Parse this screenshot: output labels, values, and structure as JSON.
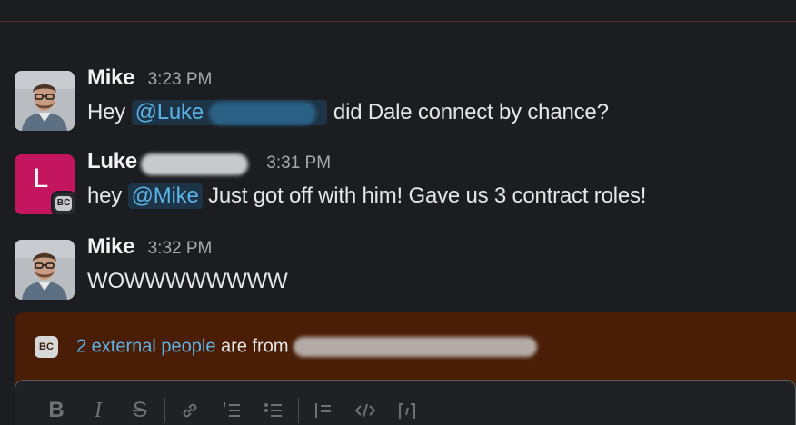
{
  "messages": [
    {
      "sender": "Mike",
      "time": "3:23 PM",
      "text_before": "Hey",
      "mention": "@Luke",
      "text_after": "did Dale connect by chance?"
    },
    {
      "sender": "Luke",
      "time": "3:31 PM",
      "avatar_letter": "L",
      "org_badge": "BC",
      "text_before": "hey",
      "mention": "@Mike",
      "text_after": "Just got off with him! Gave us 3 contract roles!"
    },
    {
      "sender": "Mike",
      "time": "3:32 PM",
      "text": "WOWWWWWWWW"
    }
  ],
  "external_banner": {
    "badge": "BC",
    "link_text": "2 external people",
    "text": "are from"
  },
  "composer_toolbar": {
    "bold": "B",
    "italic": "I",
    "strike": "S"
  },
  "colors": {
    "background": "#1b1d21",
    "mention_text": "#5cb3e8",
    "mention_bg": "#1d3446",
    "banner_bg": "#4a1e06",
    "luke_avatar": "#c4155f"
  }
}
